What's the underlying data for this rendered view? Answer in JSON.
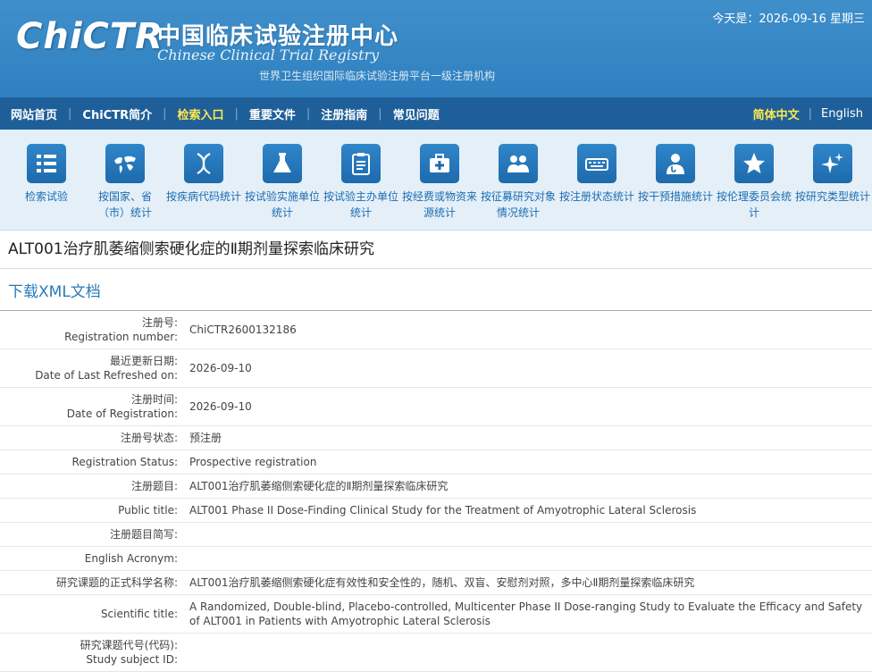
{
  "header": {
    "logo_text": "ChiCTR",
    "brand_cn": "中国临床试验注册中心",
    "brand_en": "Chinese Clinical Trial Registry",
    "brand_sub": "世界卫生组织国际临床试验注册平台一级注册机构",
    "today": "今天是：2026-09-16 星期三"
  },
  "nav": {
    "items": [
      "网站首页",
      "ChiCTR简介",
      "检索入口",
      "重要文件",
      "注册指南",
      "常见问题"
    ],
    "lang_cn": "简体中文",
    "lang_en": "English"
  },
  "iconbar": [
    {
      "label": "检索试验",
      "icon": "list-icon"
    },
    {
      "label": "按国家、省（市）统计",
      "icon": "globe-icon"
    },
    {
      "label": "按疾病代码统计",
      "icon": "dna-icon"
    },
    {
      "label": "按试验实施单位统计",
      "icon": "flask-icon"
    },
    {
      "label": "按试验主办单位统计",
      "icon": "clipboard-icon"
    },
    {
      "label": "按经费或物资来源统计",
      "icon": "medkit-icon"
    },
    {
      "label": "按征募研究对象情况统计",
      "icon": "people-icon"
    },
    {
      "label": "按注册状态统计",
      "icon": "keyboard-icon"
    },
    {
      "label": "按干预措施统计",
      "icon": "doctor-icon"
    },
    {
      "label": "按伦理委员会统计",
      "icon": "star-icon"
    },
    {
      "label": "按研究类型统计",
      "icon": "sparkle-icon"
    }
  ],
  "page_title": "ALT001治疗肌萎缩侧索硬化症的Ⅱ期剂量探索临床研究",
  "download_label": "下载XML文档",
  "rows": [
    {
      "k1": "注册号:",
      "k2": "Registration number:",
      "v": "ChiCTR2600132186",
      "tall": true
    },
    {
      "k1": "最近更新日期:",
      "k2": "Date of Last Refreshed on:",
      "v": "2026-09-10",
      "tall": true
    },
    {
      "k1": "注册时间:",
      "k2": "Date of Registration:",
      "v": "2026-09-10",
      "tall": true
    },
    {
      "k1": "注册号状态:",
      "k2": "",
      "v": "预注册",
      "tall": false
    },
    {
      "k1": "Registration Status:",
      "k2": "",
      "v": "Prospective registration",
      "tall": false
    },
    {
      "k1": "注册题目:",
      "k2": "",
      "v": "ALT001治疗肌萎缩侧索硬化症的Ⅱ期剂量探索临床研究",
      "tall": false
    },
    {
      "k1": "Public title:",
      "k2": "",
      "v": "ALT001 Phase II Dose-Finding Clinical Study for the Treatment of Amyotrophic Lateral Sclerosis",
      "tall": false
    },
    {
      "k1": "注册题目简写:",
      "k2": "",
      "v": "",
      "tall": false
    },
    {
      "k1": "English Acronym:",
      "k2": "",
      "v": "",
      "tall": false
    },
    {
      "k1": "研究课题的正式科学名称:",
      "k2": "",
      "v": "ALT001治疗肌萎缩侧索硬化症有效性和安全性的，随机、双盲、安慰剂对照，多中心Ⅱ期剂量探索临床研究",
      "tall": false
    },
    {
      "k1": "Scientific title:",
      "k2": "",
      "v": "A Randomized, Double-blind, Placebo-controlled, Multicenter Phase II Dose-ranging Study to Evaluate the Efficacy and Safety of ALT001 in Patients with Amyotrophic Lateral Sclerosis",
      "tall": true
    },
    {
      "k1": "研究课题代号(代码):",
      "k2": "Study subject ID:",
      "v": "",
      "tall": true
    }
  ]
}
